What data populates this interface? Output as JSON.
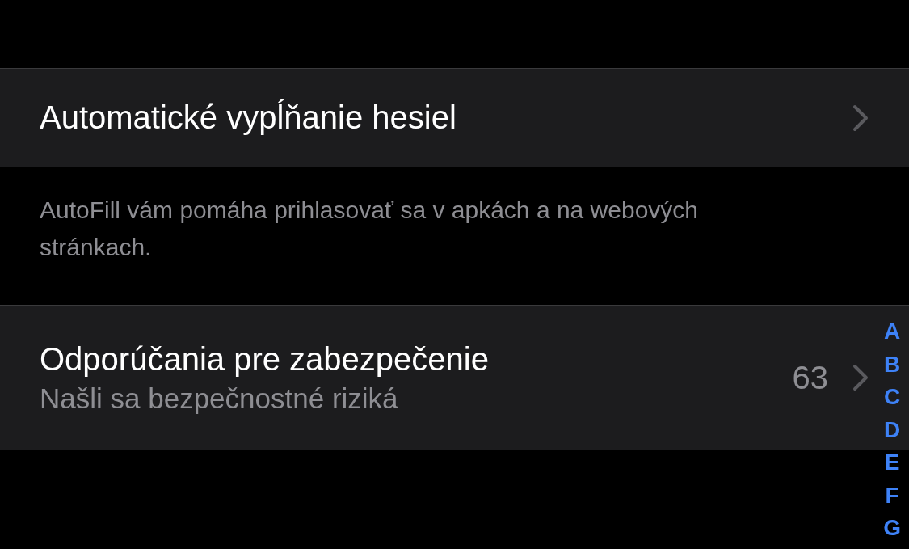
{
  "groups": [
    {
      "rows": [
        {
          "title": "Automatické vypĺňanie hesiel"
        }
      ],
      "footer": "AutoFill vám pomáha prihlasovať sa v apkách a na webových stránkach."
    },
    {
      "rows": [
        {
          "title": "Odporúčania pre zabezpečenie",
          "subtitle": "Našli sa bezpečnostné riziká",
          "count": "63"
        }
      ]
    }
  ],
  "index": [
    "A",
    "B",
    "C",
    "D",
    "E",
    "F",
    "G"
  ]
}
